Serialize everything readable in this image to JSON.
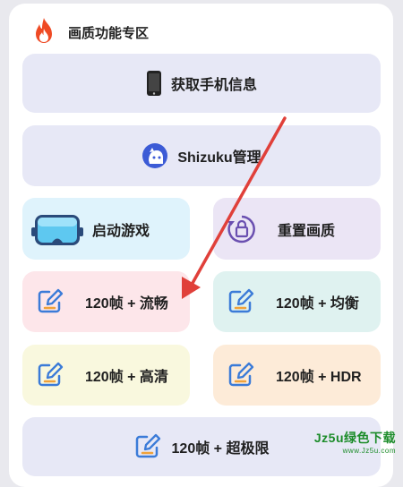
{
  "section": {
    "title": "画质功能专区",
    "icon": "flame-icon"
  },
  "buttons": {
    "device_info": "获取手机信息",
    "shizuku": "Shizuku管理",
    "start_game": "启动游戏",
    "reset_quality": "重置画质",
    "fps120_smooth": "120帧 + 流畅",
    "fps120_balanced": "120帧 + 均衡",
    "fps120_hd": "120帧 + 高清",
    "fps120_hdr": "120帧 + HDR",
    "fps120_ultra": "120帧 + 超极限"
  },
  "watermark": {
    "text": "Jz5u绿色下载",
    "sub": "www.Jz5u.com"
  },
  "colors": {
    "accent_arrow": "#e0403a",
    "edit_icon": "#3b7bd8",
    "edit_underline": "#f0a23a"
  }
}
